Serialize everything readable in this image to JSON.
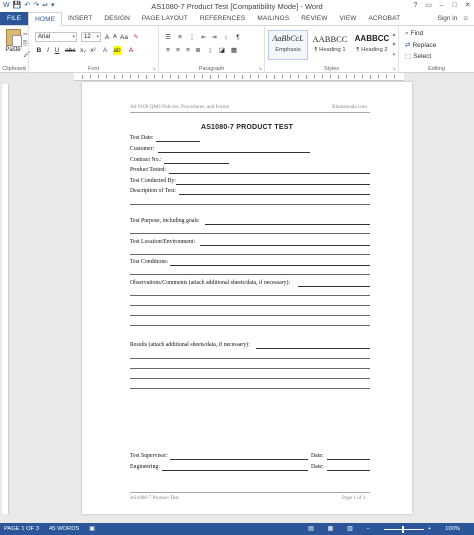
{
  "window": {
    "title": "AS1080-7 Product Test [Compatibility Mode] - Word",
    "controls": [
      "?",
      "▭",
      "–",
      "□",
      "✕"
    ]
  },
  "qat": [
    "W",
    "💾",
    "↶",
    "↷",
    "⇌",
    "▾"
  ],
  "tabs": [
    "FILE",
    "HOME",
    "INSERT",
    "DESIGN",
    "PAGE LAYOUT",
    "REFERENCES",
    "MAILINGS",
    "REVIEW",
    "VIEW",
    "ACROBAT"
  ],
  "active_tab": "HOME",
  "account": {
    "sign_in": "Sign in"
  },
  "ribbon": {
    "clipboard": {
      "label": "Clipboard",
      "paste": "Paste"
    },
    "font": {
      "label": "Font",
      "name": "Arial",
      "size": "12"
    },
    "paragraph": {
      "label": "Paragraph"
    },
    "styles": {
      "label": "Styles",
      "items": [
        {
          "preview": "AaBbCcL",
          "name": "Emphasis"
        },
        {
          "preview": "AABBCC",
          "name": "¶ Heading 1"
        },
        {
          "preview": "AABBCC",
          "name": "¶ Heading 2"
        }
      ]
    },
    "editing": {
      "label": "Editing",
      "find": "Find",
      "replace": "Replace",
      "select": "Select"
    }
  },
  "document": {
    "header_left": "AS 9100 QMS Policies, Procedures, and Forms",
    "header_right": "Bizmanualz.com",
    "title": "AS1080-7 PRODUCT TEST",
    "fields": {
      "test_date": "Test Date:",
      "customer": "Customer:",
      "contract_no": "Contract No.:",
      "product_tested": "Product Tested:",
      "test_conducted_by": "Test Conducted By:",
      "description": "Description of Test:",
      "purpose": "Test Purpose, including goals:",
      "location": "Test Location/Environment:",
      "conditions": "Test Conditions:",
      "observations": "Observations/Comments (attach additional sheets/data, if necessary):",
      "results": "Results (attach additional sheets/data, if necessary):",
      "supervisor": "Test Supervisor:",
      "engineering": "Engineering:",
      "date1": "Date:",
      "date2": "Date:"
    },
    "footer_left": "AS1080-7 Product Test",
    "footer_right": "Page 1 of 3"
  },
  "status": {
    "page": "PAGE 1 OF 3",
    "words": "45 WORDS",
    "zoom": "100%"
  },
  "colors": {
    "accent": "#2b579a"
  }
}
